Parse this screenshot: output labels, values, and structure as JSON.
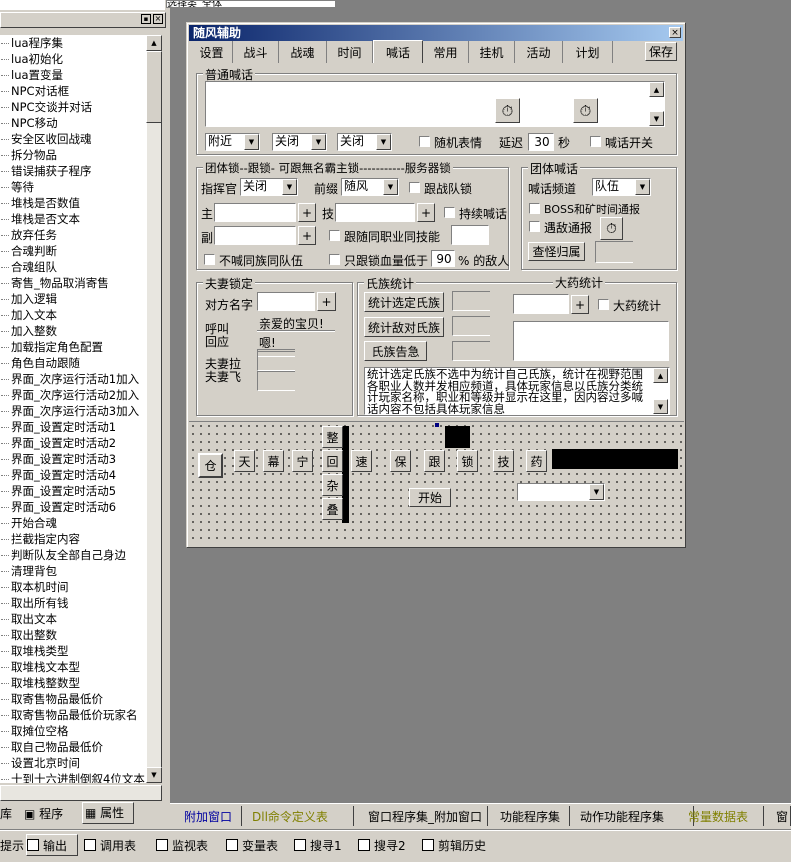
{
  "top_combo": "选择类_全体",
  "tree_items": [
    "lua程序集",
    "lua初始化",
    "lua置变量",
    "NPC对话框",
    "NPC交谈并对话",
    "NPC移动",
    "安全区收回战魂",
    "拆分物品",
    "错误捕获子程序",
    "等待",
    "堆栈是否数值",
    "堆栈是否文本",
    "放弃任务",
    "合魂判断",
    "合魂组队",
    "寄售_物品取消寄售",
    "加入逻辑",
    "加入文本",
    "加入整数",
    "加载指定角色配置",
    "角色自动跟随",
    "界面_次序运行活动1加入",
    "界面_次序运行活动2加入",
    "界面_次序运行活动3加入",
    "界面_设置定时活动1",
    "界面_设置定时活动2",
    "界面_设置定时活动3",
    "界面_设置定时活动4",
    "界面_设置定时活动5",
    "界面_设置定时活动6",
    "开始合魂",
    "拦截指定内容",
    "判断队友全部自己身边",
    "清理背包",
    "取本机时间",
    "取出所有钱",
    "取出文本",
    "取出整数",
    "取堆栈类型",
    "取堆栈文本型",
    "取堆栈整数型",
    "取寄售物品最低价",
    "取寄售物品最低价玩家名",
    "取摊位空格",
    "取自己物品最低价",
    "设置北京时间",
    "十到十六进制倒叙4位文本"
  ],
  "left_tabs": {
    "lib": "库",
    "program": "程序",
    "props": "属性"
  },
  "window": {
    "title": "随风辅助",
    "close": "×"
  },
  "tabs": [
    "设置",
    "战斗",
    "战魂",
    "时间",
    "喊话",
    "常用",
    "挂机",
    "活动",
    "计划"
  ],
  "save": "保存",
  "shout": {
    "group": "普通喊话",
    "range": "附近",
    "opt1": "关闭",
    "opt2": "关闭",
    "random": "随机表情",
    "delay_label": "延迟",
    "delay": "30",
    "sec": "秒",
    "switch": "喊话开关"
  },
  "team": {
    "group": "团体锁--跟锁- 可跟無名霸主锁-----------服务器锁",
    "commander": "指挥官",
    "cmd_val": "关闭",
    "prefix": "前缀",
    "prefix_val": "随风",
    "follow_war": "跟战队锁",
    "main": "主",
    "skill": "技",
    "keep_shout": "持续喊话",
    "vice": "副",
    "follow_same": "跟随同职业同技能",
    "no_shout": "不喊同族同队伍",
    "only_follow": "只跟锁血量低于",
    "hp": "90",
    "percent": "% 的敌人",
    "plus": "+"
  },
  "team_shout": {
    "group": "团体喊话",
    "channel_label": "喊话频道",
    "channel": "队伍",
    "boss": "BOSS和矿时间通报",
    "enemy": "遇敌通报",
    "check": "查怪归属"
  },
  "couple": {
    "group": "夫妻锁定",
    "name": "对方名字",
    "call1": "呼叫",
    "call2": "回应",
    "msg1": "亲爱的宝贝!",
    "msg2": "嗯!",
    "pull1": "夫妻拉",
    "pull2": "夫妻飞"
  },
  "clan": {
    "group": "氏族统计",
    "btn1": "统计选定氏族",
    "btn2": "统计敌对氏族",
    "btn3": "氏族告急",
    "medicine": "大药统计",
    "med_chk": "大药统计",
    "desc": "统计选定氏族不选中为统计自己氏族，统计在视野范围各职业人数并发相应频道，具体玩家信息以氏族分类统计玩家名称，职业和等级并显示在这里，因内容过多喊话内容不包括具体玩家信息"
  },
  "bottom": {
    "left": "仓",
    "keys": [
      "天",
      "幕",
      "宁"
    ],
    "vert": [
      "整",
      "回",
      "杂",
      "叠"
    ],
    "keys2": [
      "速",
      "保",
      "跟",
      "锁",
      "技",
      "药"
    ],
    "start": "开始"
  },
  "ide_tabs": [
    "附加窗口",
    "Dll命令定义表",
    "窗口程序集_附加窗口",
    "功能程序集",
    "动作功能程序集",
    "常量数据表",
    "窗"
  ],
  "status_tabs": [
    "提示",
    "输出",
    "调用表",
    "监视表",
    "变量表",
    "搜寻1",
    "搜寻2",
    "剪辑历史"
  ]
}
